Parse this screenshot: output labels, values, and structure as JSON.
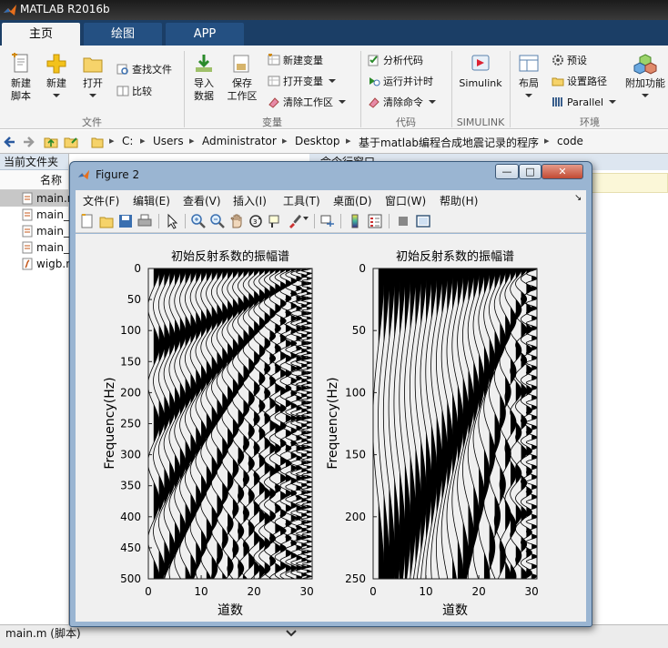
{
  "app": {
    "title": "MATLAB R2016b"
  },
  "tabs": [
    {
      "label": "主页"
    },
    {
      "label": "绘图"
    },
    {
      "label": "APP"
    }
  ],
  "ribbon": {
    "new_script": "新建\n脚本",
    "new": "新建",
    "open": "打开",
    "find_files": "查找文件",
    "compare": "比较",
    "import_data": "导入\n数据",
    "save_workspace": "保存\n工作区",
    "new_variable": "新建变量",
    "open_variable": "打开变量",
    "clear_workspace": "清除工作区",
    "analyze_code": "分析代码",
    "run_and_time": "运行并计时",
    "clear_commands": "清除命令",
    "simulink": "Simulink",
    "layout": "布局",
    "preferences": "预设",
    "set_path": "设置路径",
    "parallel": "Parallel",
    "addons": "附加功能",
    "groups": {
      "file": "文件",
      "variable": "变量",
      "code": "代码",
      "simulink": "SIMULINK",
      "environment": "环境"
    }
  },
  "address": {
    "segments": [
      "C:",
      "Users",
      "Administrator",
      "Desktop",
      "基于matlab编程合成地震记录的程序",
      "code"
    ]
  },
  "current_folder": {
    "title": "当前文件夹",
    "column_name": "名称",
    "files": [
      "main.m",
      "main_",
      "main_",
      "main_",
      "wigb.m"
    ]
  },
  "command_window": {
    "title": "命令行窗口"
  },
  "bottom": {
    "selected_file": "main.m  (脚本)"
  },
  "figure": {
    "title": "Figure 2",
    "menus": [
      "文件(F)",
      "编辑(E)",
      "查看(V)",
      "插入(I)",
      "工具(T)",
      "桌面(D)",
      "窗口(W)",
      "帮助(H)"
    ]
  },
  "chart_data": [
    {
      "type": "wiggle",
      "title": "初始反射系数的振幅谱",
      "xlabel": "道数",
      "ylabel": "Frequency(Hz)",
      "xlim": [
        0,
        31
      ],
      "ylim": [
        0,
        500
      ],
      "y_reversed": true,
      "xticks": [
        0,
        10,
        20,
        30
      ],
      "yticks": [
        0,
        50,
        100,
        150,
        200,
        250,
        300,
        350,
        400,
        450,
        500
      ],
      "traces": 30,
      "ripple_period_traces_1": 125,
      "ripple_period_traces_30": 8
    },
    {
      "type": "wiggle",
      "title": "初始反射系数的振幅谱",
      "xlabel": "道数",
      "ylabel": "Frequency(Hz)",
      "xlim": [
        0,
        31
      ],
      "ylim": [
        0,
        250
      ],
      "y_reversed": true,
      "xticks": [
        0,
        10,
        20,
        30
      ],
      "yticks": [
        0,
        50,
        100,
        150,
        200,
        250
      ],
      "traces": 30,
      "ripple_period_traces_1": 250,
      "ripple_period_traces_30": 8
    }
  ]
}
